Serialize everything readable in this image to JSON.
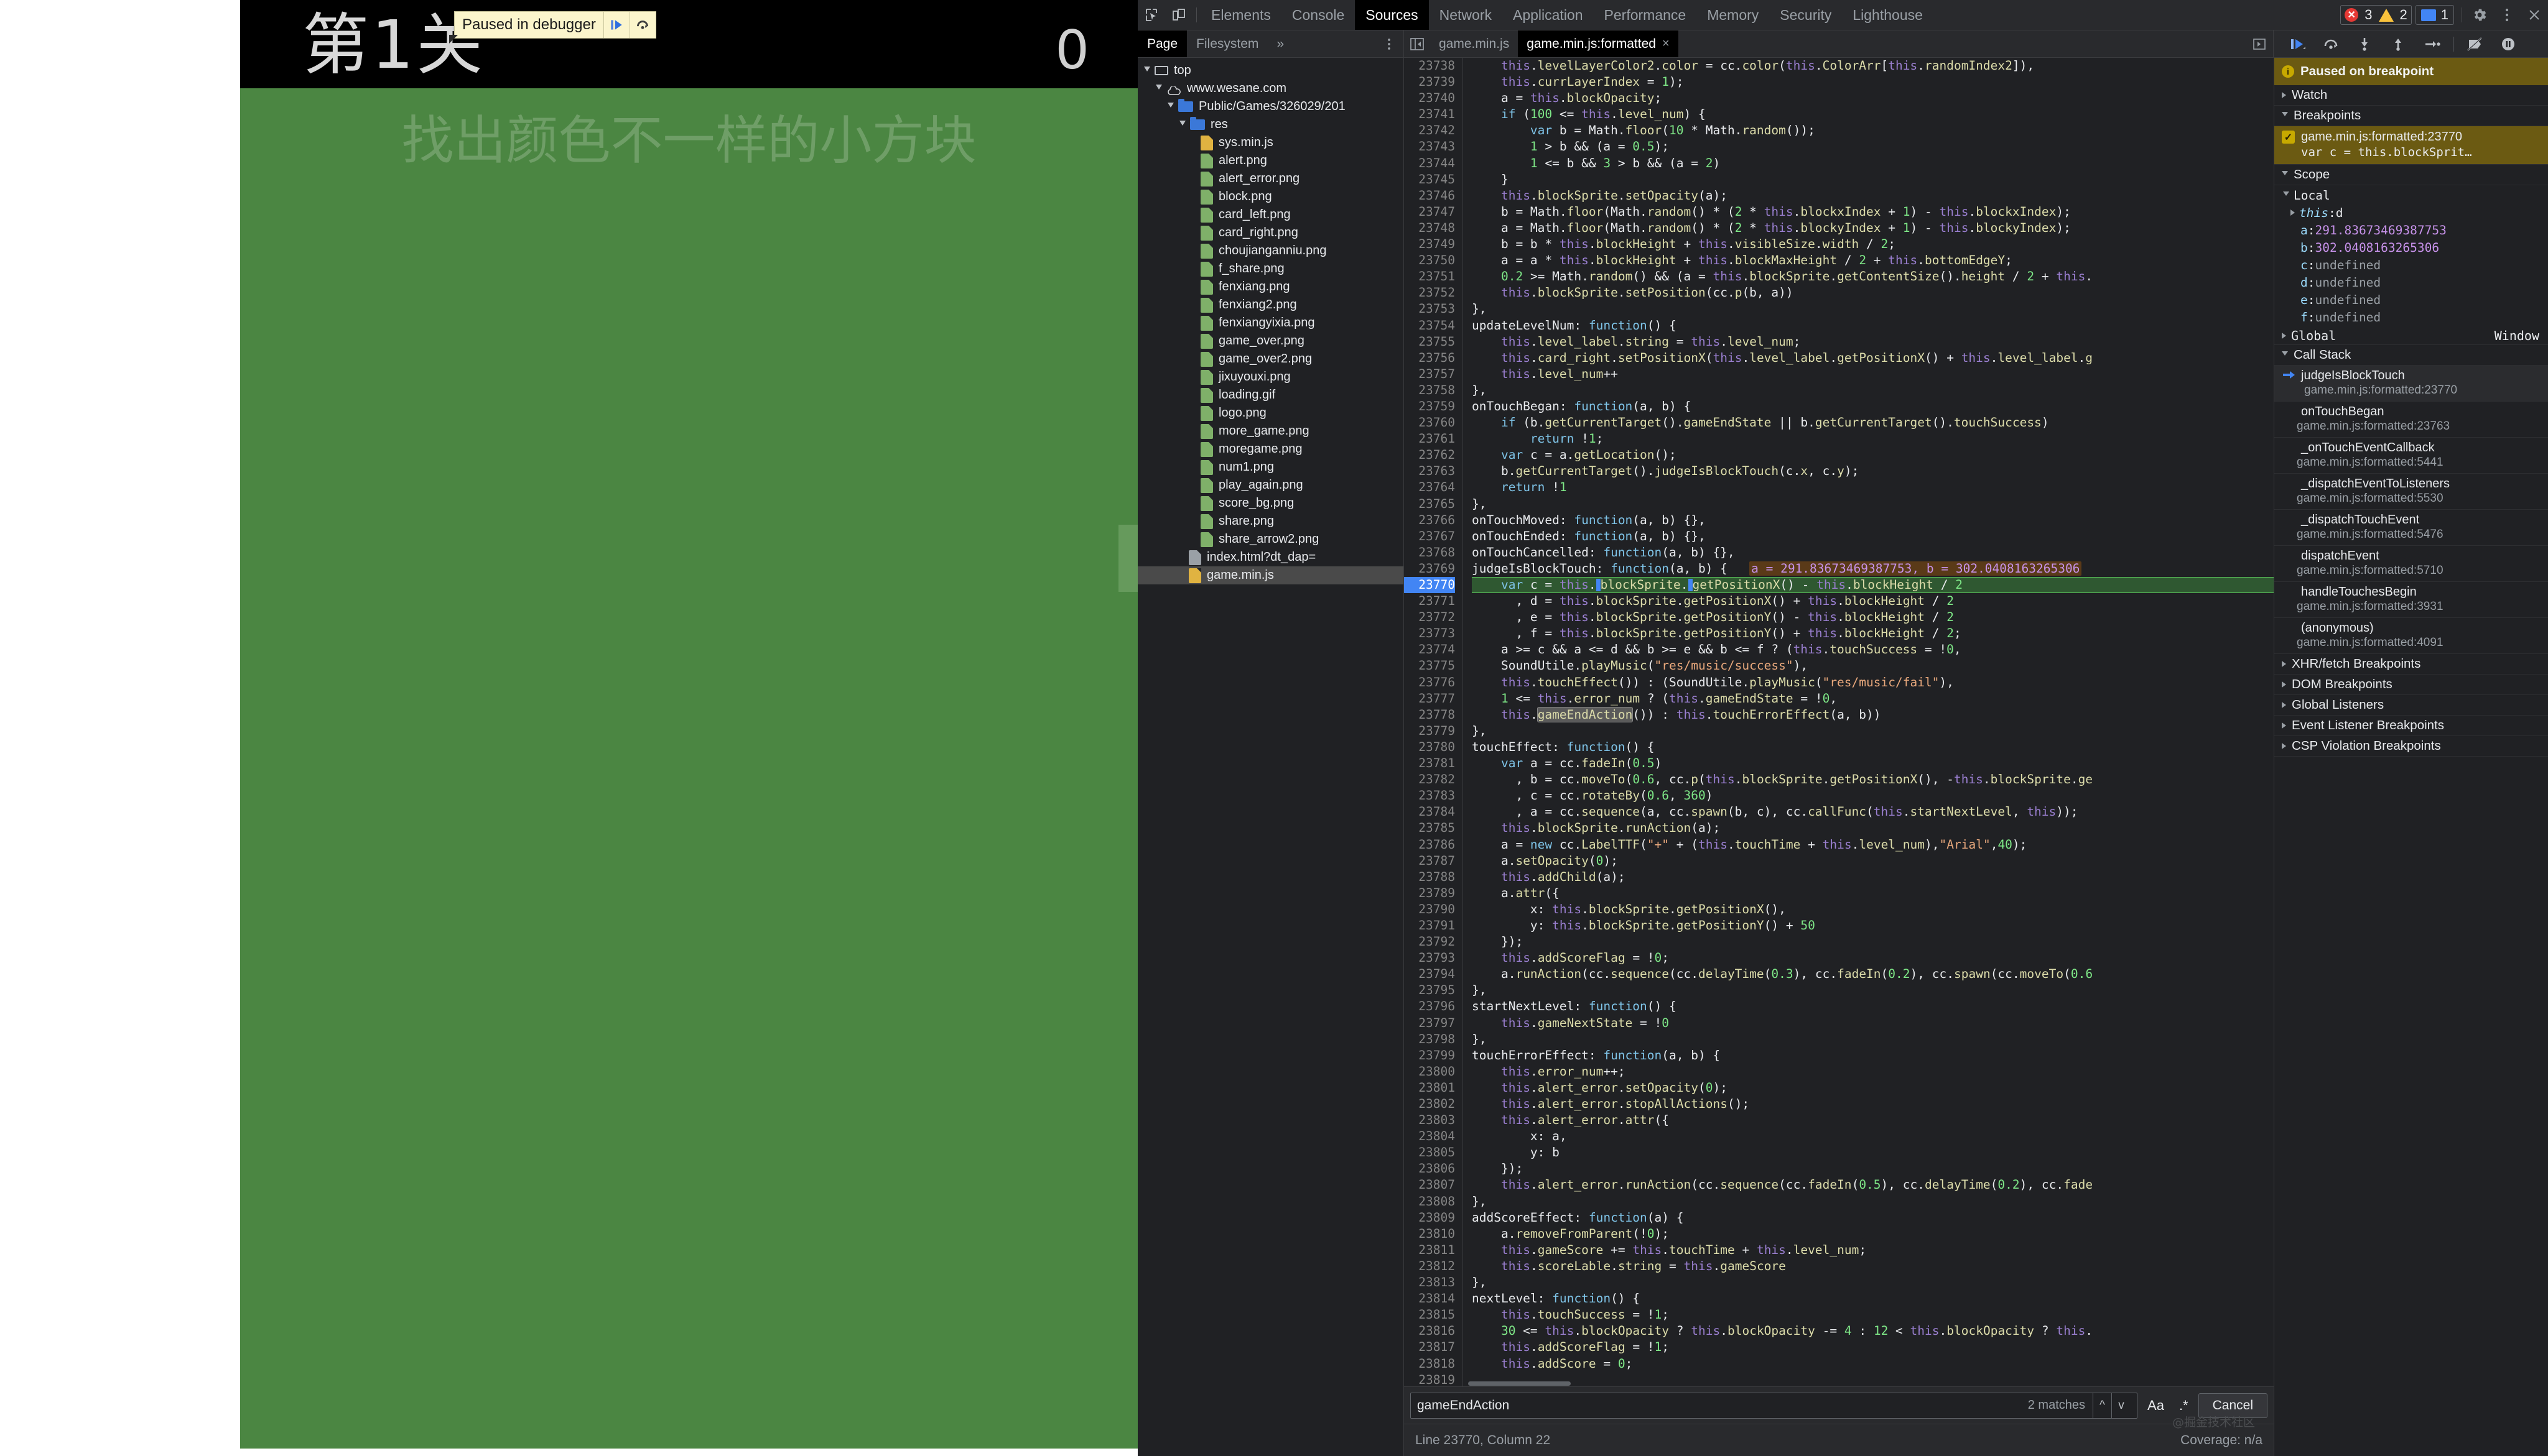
{
  "game": {
    "level_label": "第1关",
    "score_label": "0",
    "hint": "找出颜色不一样的小方块",
    "bg_color": "#4b8642",
    "block_color": "#669a5c",
    "header_bg": "#000000",
    "paused_banner": {
      "text": "Paused in debugger",
      "resume_icon": "resume-icon",
      "step-over_icon": "step-over-icon"
    }
  },
  "devtools": {
    "toolbar": {
      "inspect_icon": "inspect-element-icon",
      "device_icon": "device-toolbar-icon",
      "tabs": [
        {
          "label": "Elements",
          "active": false
        },
        {
          "label": "Console",
          "active": false
        },
        {
          "label": "Sources",
          "active": true
        },
        {
          "label": "Network",
          "active": false
        },
        {
          "label": "Application",
          "active": false
        },
        {
          "label": "Performance",
          "active": false
        },
        {
          "label": "Memory",
          "active": false
        },
        {
          "label": "Security",
          "active": false
        },
        {
          "label": "Lighthouse",
          "active": false
        }
      ],
      "errors_count": "3",
      "warnings_count": "2",
      "messages_count": "1",
      "settings_icon": "gear-icon",
      "more_icon": "more-vertical-icon",
      "close_icon": "close-icon"
    },
    "navigator": {
      "tabs": [
        {
          "label": "Page",
          "active": true
        },
        {
          "label": "Filesystem",
          "active": false
        }
      ],
      "more_label": "»",
      "dots_icon": "more-vertical-icon",
      "tree": [
        {
          "label": "top",
          "indent": 0,
          "icon": "frame-icon",
          "expanded": true
        },
        {
          "label": "www.wesane.com",
          "indent": 1,
          "icon": "cloud-icon",
          "expanded": true
        },
        {
          "label": "Public/Games/326029/201",
          "indent": 2,
          "icon": "folder-blue-icon",
          "expanded": true
        },
        {
          "label": "res",
          "indent": 3,
          "icon": "folder-blue-icon",
          "expanded": true
        },
        {
          "label": "sys.min.js",
          "indent": 4,
          "icon": "file-js-icon"
        },
        {
          "label": "alert.png",
          "indent": 4,
          "icon": "file-img-icon"
        },
        {
          "label": "alert_error.png",
          "indent": 4,
          "icon": "file-img-icon"
        },
        {
          "label": "block.png",
          "indent": 4,
          "icon": "file-img-icon"
        },
        {
          "label": "card_left.png",
          "indent": 4,
          "icon": "file-img-icon"
        },
        {
          "label": "card_right.png",
          "indent": 4,
          "icon": "file-img-icon"
        },
        {
          "label": "choujianganniu.png",
          "indent": 4,
          "icon": "file-img-icon"
        },
        {
          "label": "f_share.png",
          "indent": 4,
          "icon": "file-img-icon"
        },
        {
          "label": "fenxiang.png",
          "indent": 4,
          "icon": "file-img-icon"
        },
        {
          "label": "fenxiang2.png",
          "indent": 4,
          "icon": "file-img-icon"
        },
        {
          "label": "fenxiangyixia.png",
          "indent": 4,
          "icon": "file-img-icon"
        },
        {
          "label": "game_over.png",
          "indent": 4,
          "icon": "file-img-icon"
        },
        {
          "label": "game_over2.png",
          "indent": 4,
          "icon": "file-img-icon"
        },
        {
          "label": "jixuyouxi.png",
          "indent": 4,
          "icon": "file-img-icon"
        },
        {
          "label": "loading.gif",
          "indent": 4,
          "icon": "file-img-icon"
        },
        {
          "label": "logo.png",
          "indent": 4,
          "icon": "file-img-icon"
        },
        {
          "label": "more_game.png",
          "indent": 4,
          "icon": "file-img-icon"
        },
        {
          "label": "moregame.png",
          "indent": 4,
          "icon": "file-img-icon"
        },
        {
          "label": "num1.png",
          "indent": 4,
          "icon": "file-img-icon"
        },
        {
          "label": "play_again.png",
          "indent": 4,
          "icon": "file-img-icon"
        },
        {
          "label": "score_bg.png",
          "indent": 4,
          "icon": "file-img-icon"
        },
        {
          "label": "share.png",
          "indent": 4,
          "icon": "file-img-icon"
        },
        {
          "label": "share_arrow2.png",
          "indent": 4,
          "icon": "file-img-icon"
        },
        {
          "label": "index.html?dt_dap=",
          "indent": 3,
          "icon": "file-doc-icon"
        },
        {
          "label": "game.min.js",
          "indent": 3,
          "icon": "file-js-icon",
          "selected": true
        }
      ]
    },
    "editor_tabs": {
      "nav_icon": "panel-toggle-icon",
      "tabs": [
        {
          "label": "game.min.js",
          "active": false
        },
        {
          "label": "game.min.js:formatted",
          "active": true,
          "close": "×"
        }
      ],
      "right_icon": "panel-toggle-right-icon"
    },
    "debug_controls": [
      {
        "name": "resume-icon",
        "label": "Resume script execution"
      },
      {
        "name": "step-over-icon",
        "label": "Step over next function call"
      },
      {
        "name": "step-into-icon",
        "label": "Step into next function call"
      },
      {
        "name": "step-out-icon",
        "label": "Step out of current function"
      },
      {
        "name": "step-icon",
        "label": "Step"
      },
      {
        "name": "deactivate-breakpoints-icon",
        "label": "Deactivate breakpoints"
      },
      {
        "name": "pause-on-exceptions-icon",
        "label": "Pause on exceptions"
      }
    ],
    "code": {
      "first_line": 23738,
      "paused_line": 23770,
      "inline_values": "a = 291.83673469387753, b = 302.0408163265306",
      "lines": [
        "    this.levelLayerColor2.color = cc.color(this.ColorArr[this.randomIndex2]),",
        "    this.currLayerIndex = 1);",
        "    a = this.blockOpacity;",
        "    if (100 <= this.level_num) {",
        "        var b = Math.floor(10 * Math.random());",
        "        1 > b && (a = 0.5);",
        "        1 <= b && 3 > b && (a = 2)",
        "    }",
        "    this.blockSprite.setOpacity(a);",
        "    b = Math.floor(Math.random() * (2 * this.blockxIndex + 1) - this.blockxIndex);",
        "    a = Math.floor(Math.random() * (2 * this.blockyIndex + 1) - this.blockyIndex);",
        "    b = b * this.blockHeight + this.visibleSize.width / 2;",
        "    a = a * this.blockHeight + this.blockMaxHeight / 2 + this.bottomEdgeY;",
        "    0.2 >= Math.random() && (a = this.blockSprite.getContentSize().height / 2 + this.",
        "    this.blockSprite.setPosition(cc.p(b, a))",
        "},",
        "updateLevelNum: function() {",
        "    this.level_label.string = this.level_num;",
        "    this.card_right.setPositionX(this.level_label.getPositionX() + this.level_label.g",
        "    this.level_num++",
        "},",
        "onTouchBegan: function(a, b) {",
        "    if (b.getCurrentTarget().gameEndState || b.getCurrentTarget().touchSuccess)",
        "        return !1;",
        "    var c = a.getLocation();",
        "    b.getCurrentTarget().judgeIsBlockTouch(c.x, c.y);",
        "    return !1",
        "},",
        "onTouchMoved: function(a, b) {},",
        "onTouchEnded: function(a, b) {},",
        "onTouchCancelled: function(a, b) {},",
        "judgeIsBlockTouch: function(a, b) {",
        "    var c = this.blockSprite.getPositionX() - this.blockHeight / 2",
        "      , d = this.blockSprite.getPositionX() + this.blockHeight / 2",
        "      , e = this.blockSprite.getPositionY() - this.blockHeight / 2",
        "      , f = this.blockSprite.getPositionY() + this.blockHeight / 2;",
        "    a >= c && a <= d && b >= e && b <= f ? (this.touchSuccess = !0,",
        "    SoundUtile.playMusic(\"res/music/success\"),",
        "    this.touchEffect()) : (SoundUtile.playMusic(\"res/music/fail\"),",
        "    1 <= this.error_num ? (this.gameEndState = !0,",
        "    this.gameEndAction()) : this.touchErrorEffect(a, b))",
        "},",
        "touchEffect: function() {",
        "    var a = cc.fadeIn(0.5)",
        "      , b = cc.moveTo(0.6, cc.p(this.blockSprite.getPositionX(), -this.blockSprite.ge",
        "      , c = cc.rotateBy(0.6, 360)",
        "      , a = cc.sequence(a, cc.spawn(b, c), cc.callFunc(this.startNextLevel, this));",
        "    this.blockSprite.runAction(a);",
        "    a = new cc.LabelTTF(\"+\" + (this.touchTime + this.level_num),\"Arial\",40);",
        "    a.setOpacity(0);",
        "    this.addChild(a);",
        "    a.attr({",
        "        x: this.blockSprite.getPositionX(),",
        "        y: this.blockSprite.getPositionY() + 50",
        "    });",
        "    this.addScoreFlag = !0;",
        "    a.runAction(cc.sequence(cc.delayTime(0.3), cc.fadeIn(0.2), cc.spawn(cc.moveTo(0.6",
        "},",
        "startNextLevel: function() {",
        "    this.gameNextState = !0",
        "},",
        "touchErrorEffect: function(a, b) {",
        "    this.error_num++;",
        "    this.alert_error.setOpacity(0);",
        "    this.alert_error.stopAllActions();",
        "    this.alert_error.attr({",
        "        x: a,",
        "        y: b",
        "    });",
        "    this.alert_error.runAction(cc.sequence(cc.fadeIn(0.5), cc.delayTime(0.2), cc.fade",
        "},",
        "addScoreEffect: function(a) {",
        "    a.removeFromParent(!0);",
        "    this.gameScore += this.touchTime + this.level_num;",
        "    this.scoreLable.string = this.gameScore",
        "},",
        "nextLevel: function() {",
        "    this.touchSuccess = !1;",
        "    30 <= this.blockOpacity ? this.blockOpacity -= 4 : 12 < this.blockOpacity ? this.",
        "    this.addScoreFlag = !1;",
        "    this.addScore = 0;",
        ""
      ]
    },
    "search": {
      "value": "gameEndAction",
      "matches": "2 matches",
      "prev_icon": "chevron-up-icon",
      "next_icon": "chevron-down-icon",
      "match_case_label": "Aa",
      "regex_label": ".*",
      "cancel_label": "Cancel"
    },
    "status": {
      "position": "Line 23770, Column 22",
      "coverage": "Coverage: n/a",
      "watermark": "@掘金技术社区"
    },
    "sidebar": {
      "paused_title": "Paused on breakpoint",
      "watch_label": "Watch",
      "breakpoints_label": "Breakpoints",
      "breakpoint": {
        "location": "game.min.js:formatted:23770",
        "snippet": "var c = this.blockSprit…"
      },
      "scope_label": "Scope",
      "local_label": "Local",
      "locals": [
        {
          "key": "this",
          "value": "d",
          "italic": true,
          "expandable": true
        },
        {
          "key": "a",
          "value": "291.83673469387753",
          "expandable": false
        },
        {
          "key": "b",
          "value": "302.0408163265306",
          "expandable": false
        },
        {
          "key": "c",
          "value": "undefined",
          "undef": true
        },
        {
          "key": "d",
          "value": "undefined",
          "undef": true
        },
        {
          "key": "e",
          "value": "undefined",
          "undef": true
        },
        {
          "key": "f",
          "value": "undefined",
          "undef": true
        }
      ],
      "global_label": "Global",
      "global_value": "Window",
      "call_stack_label": "Call Stack",
      "call_stack": [
        {
          "fn": "judgeIsBlockTouch",
          "loc": "game.min.js:formatted:23770",
          "active": true
        },
        {
          "fn": "onTouchBegan",
          "loc": "game.min.js:formatted:23763",
          "active": false
        },
        {
          "fn": "_onTouchEventCallback",
          "loc": "game.min.js:formatted:5441",
          "active": false
        },
        {
          "fn": "_dispatchEventToListeners",
          "loc": "game.min.js:formatted:5530",
          "active": false
        },
        {
          "fn": "_dispatchTouchEvent",
          "loc": "game.min.js:formatted:5476",
          "active": false
        },
        {
          "fn": "dispatchEvent",
          "loc": "game.min.js:formatted:5710",
          "active": false
        },
        {
          "fn": "handleTouchesBegin",
          "loc": "game.min.js:formatted:3931",
          "active": false
        },
        {
          "fn": "(anonymous)",
          "loc": "game.min.js:formatted:4091",
          "active": false
        }
      ],
      "accordions": [
        "XHR/fetch Breakpoints",
        "DOM Breakpoints",
        "Global Listeners",
        "Event Listener Breakpoints",
        "CSP Violation Breakpoints"
      ]
    }
  }
}
